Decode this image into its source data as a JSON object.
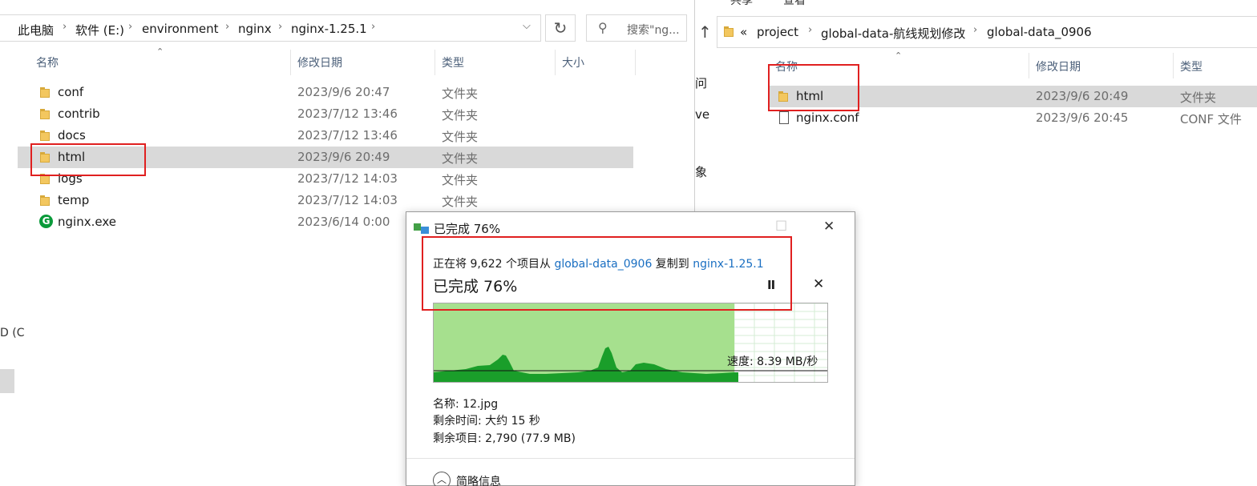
{
  "left_window": {
    "breadcrumb": [
      "此电脑",
      "软件 (E:)",
      "environment",
      "nginx",
      "nginx-1.25.1"
    ],
    "search_placeholder": "搜索\"ng...",
    "columns": {
      "name": "名称",
      "date": "修改日期",
      "type": "类型",
      "size": "大小"
    },
    "files": [
      {
        "name": "conf",
        "date": "2023/9/6 20:47",
        "type": "文件夹",
        "icon": "folder-icon",
        "selected": false
      },
      {
        "name": "contrib",
        "date": "2023/7/12 13:46",
        "type": "文件夹",
        "icon": "folder-icon",
        "selected": false
      },
      {
        "name": "docs",
        "date": "2023/7/12 13:46",
        "type": "文件夹",
        "icon": "folder-icon",
        "selected": false
      },
      {
        "name": "html",
        "date": "2023/9/6 20:49",
        "type": "文件夹",
        "icon": "folder-icon",
        "selected": true
      },
      {
        "name": "logs",
        "date": "2023/7/12 14:03",
        "type": "文件夹",
        "icon": "folder-icon",
        "selected": false
      },
      {
        "name": "temp",
        "date": "2023/7/12 14:03",
        "type": "文件夹",
        "icon": "folder-icon",
        "selected": false
      },
      {
        "name": "nginx.exe",
        "date": "2023/6/14 0:00",
        "type": "",
        "icon": "nginx-exe-icon",
        "selected": false
      }
    ],
    "side_stub": "D (C"
  },
  "right_window": {
    "top_tabs": [
      "共享",
      "查看"
    ],
    "breadcrumb_prefix": "«",
    "breadcrumb": [
      "project",
      "global-data-航线规划修改",
      "global-data_0906"
    ],
    "nav_stubs": [
      "问",
      "ve",
      "象"
    ],
    "columns": {
      "name": "名称",
      "date": "修改日期",
      "type": "类型"
    },
    "files": [
      {
        "name": "html",
        "date": "2023/9/6 20:49",
        "type": "文件夹",
        "icon": "folder-icon",
        "selected": true
      },
      {
        "name": "nginx.conf",
        "date": "2023/9/6 20:45",
        "type": "CONF 文件",
        "icon": "file-icon",
        "selected": false
      }
    ]
  },
  "copy_dialog": {
    "title": "已完成 76%",
    "status_prefix": "正在将 9,622 个项目从 ",
    "source": "global-data_0906",
    "status_mid": " 复制到 ",
    "destination": "nginx-1.25.1",
    "progress_text": "已完成 76%",
    "progress": 0.76,
    "speed_label": "速度: 8.39 MB/秒",
    "name_label": "名称: 12.jpg",
    "time_remaining": "剩余时间: 大约 15 秒",
    "items_remaining": "剩余项目: 2,790 (77.9 MB)",
    "details_toggle": "简略信息",
    "pause_symbol": "II",
    "close_symbol": "✕",
    "maximize_symbol": "☐"
  },
  "colors": {
    "highlight": "#e02020",
    "link": "#1a6fc2",
    "progress_fill": "#a6e08e",
    "throughput": "#1a9e2a",
    "selected_row": "#d9d9d9"
  }
}
